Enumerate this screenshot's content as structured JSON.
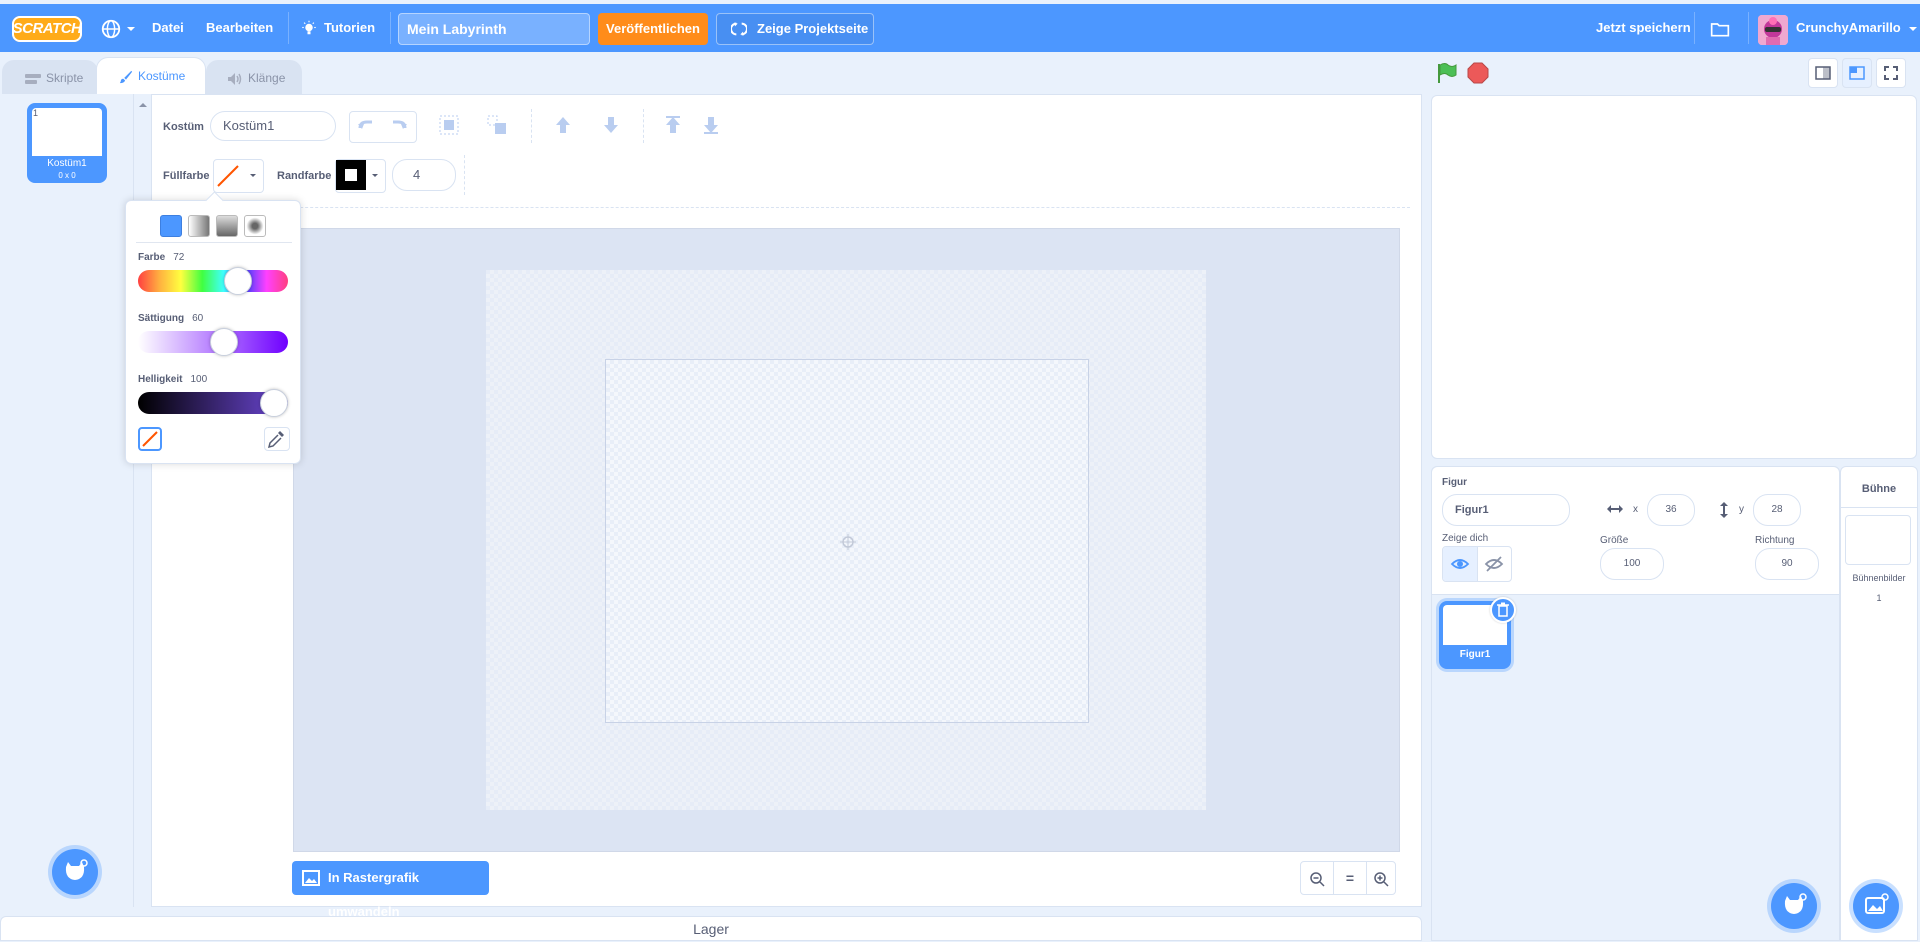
{
  "menubar": {
    "logo": "SCRATCH",
    "file": "Datei",
    "edit": "Bearbeiten",
    "tutorials": "Tutorien",
    "project_title": "Mein Labyrinth",
    "publish": "Veröffentlichen",
    "see_project": "Zeige Projektseite",
    "save_now": "Jetzt speichern",
    "username": "CrunchyAmarillo"
  },
  "tabs": {
    "code": "Skripte",
    "costumes": "Kostüme",
    "sounds": "Klänge"
  },
  "costume_list": {
    "items": [
      {
        "number": "1",
        "name": "Kostüm1",
        "size": "0 x 0"
      }
    ]
  },
  "paint_editor": {
    "costume_label": "Kostüm",
    "costume_name": "Kostüm1",
    "fill_label": "Füllfarbe",
    "outline_label": "Randfarbe",
    "outline_width": "4",
    "convert_button": "In Rastergrafik umwandeln",
    "zoom_reset": "="
  },
  "color_picker": {
    "color_label": "Farbe",
    "color_value": "72",
    "saturation_label": "Sättigung",
    "saturation_value": "60",
    "brightness_label": "Helligkeit",
    "brightness_value": "100"
  },
  "backpack": {
    "label": "Lager"
  },
  "sprite_info": {
    "sprite_label": "Figur",
    "sprite_name": "Figur1",
    "x_label": "x",
    "x_value": "36",
    "y_label": "y",
    "y_value": "28",
    "show_label": "Zeige dich",
    "size_label": "Größe",
    "size_value": "100",
    "direction_label": "Richtung",
    "direction_value": "90"
  },
  "sprites": [
    {
      "name": "Figur1"
    }
  ],
  "stage_panel": {
    "title": "Bühne",
    "backdrops_label": "Bühnenbilder",
    "backdrops_count": "1"
  },
  "colors": {
    "brand_blue": "#4c97ff",
    "publish_orange": "#ff8c1a",
    "menubar": "#4c97ff",
    "stop_red": "#ec5959",
    "flag_green": "#4cbf56"
  }
}
